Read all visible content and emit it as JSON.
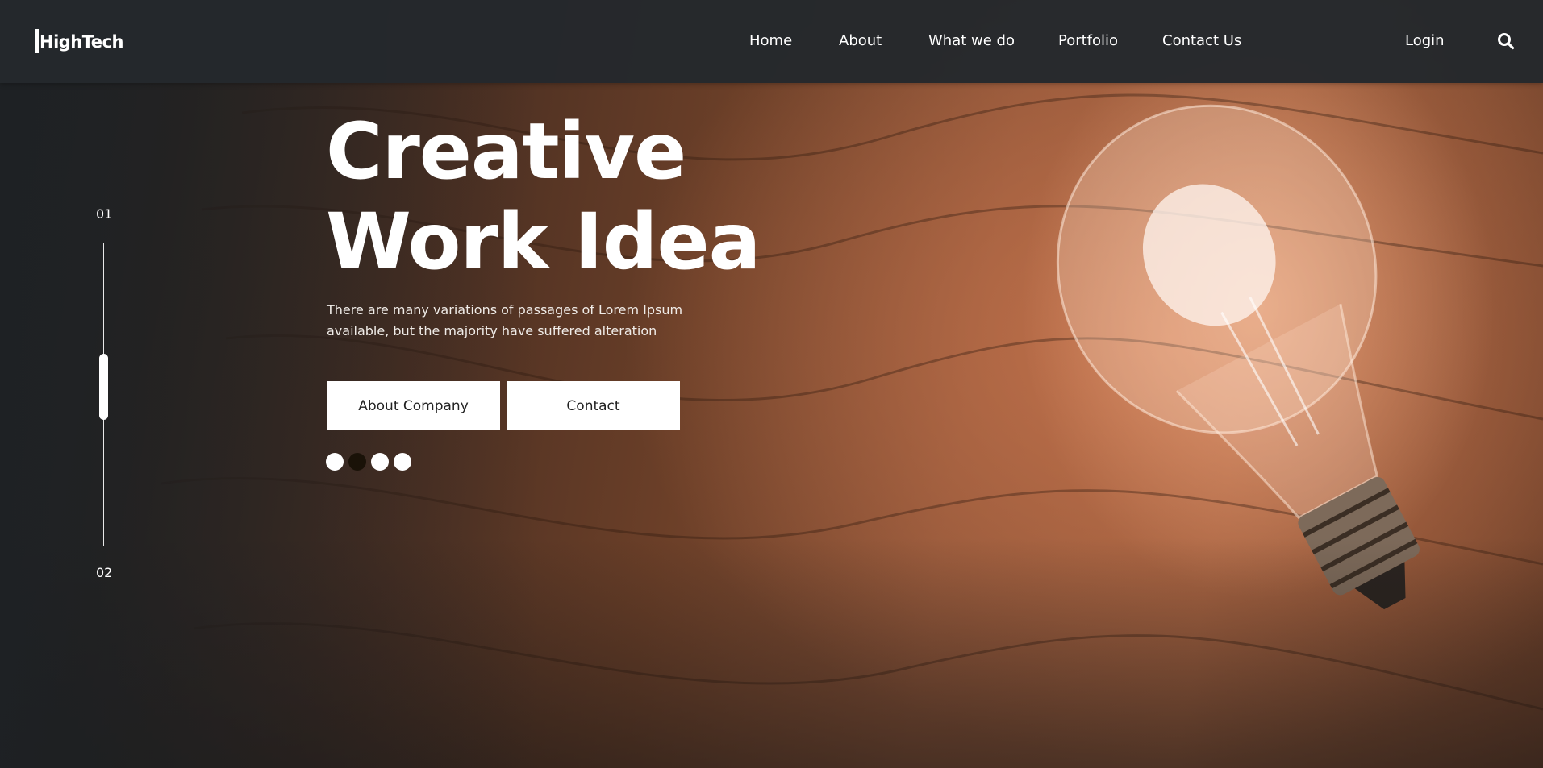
{
  "brand": {
    "logo_text": "HighTech"
  },
  "nav": {
    "items": [
      {
        "label": "Home"
      },
      {
        "label": "About"
      },
      {
        "label": "What we do"
      },
      {
        "label": "Portfolio"
      },
      {
        "label": "Contact Us"
      }
    ],
    "login_label": "Login",
    "search_icon": "search-icon"
  },
  "slider": {
    "current": "01",
    "next": "02",
    "progress_fraction": 0.5,
    "dot_count": 4,
    "active_dot": 2
  },
  "hero": {
    "title_line1": "Creative",
    "title_line2": "Work Idea",
    "subtitle": "There are many variations of passages of Lorem Ipsum available, but the majority have suffered alteration",
    "primary_button": "About Company",
    "secondary_button": "Contact"
  },
  "colors": {
    "header_bg": "#24282c",
    "text": "#ffffff",
    "button_bg": "#ffffff",
    "active_dot": "#1a1208"
  }
}
